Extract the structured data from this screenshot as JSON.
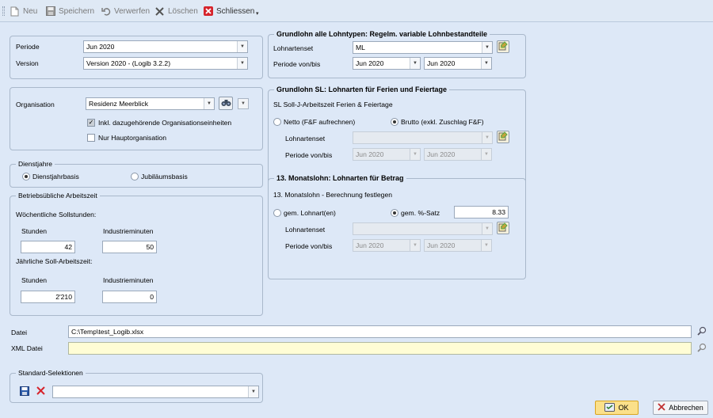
{
  "toolbar": {
    "neu": "Neu",
    "speichern": "Speichern",
    "verwerfen": "Verwerfen",
    "loeschen": "Löschen",
    "schliessen": "Schliessen",
    "overflow": "▾"
  },
  "periode": {
    "label": "Periode",
    "value": "Jun 2020"
  },
  "version": {
    "label": "Version",
    "value": "Version 2020 - (Logib 3.2.2)"
  },
  "organisation": {
    "label": "Organisation",
    "value": "Residenz Meerblick",
    "chk_inkl": "Inkl. dazugehörende Organisationseinheiten",
    "chk_inkl_checked": true,
    "chk_haupt": "Nur Hauptorganisation",
    "chk_haupt_checked": false
  },
  "dienstjahre": {
    "title": "Dienstjahre",
    "opt1": "Dienstjahrbasis",
    "opt2": "Jubiläumsbasis",
    "selected": "Dienstjahrbasis"
  },
  "arbeitszeit": {
    "title": "Betriebsübliche Arbeitszeit",
    "weekly_label": "Wöchentliche Sollstunden:",
    "yearly_label": "Jährliche Soll-Arbeitszeit:",
    "stunden_label": "Stunden",
    "industrie_label": "Industrieminuten",
    "weekly_stunden": "42",
    "weekly_industrie": "50",
    "yearly_stunden": "2'210",
    "yearly_industrie": "0"
  },
  "grundlohn_alle": {
    "title": "Grundlohn alle Lohntypen: Regelm. variable Lohnbestandteile",
    "lohnartenset_label": "Lohnartenset",
    "lohnartenset_value": "ML",
    "periode_label": "Periode von/bis",
    "von": "Jun 2020",
    "bis": "Jun 2020"
  },
  "grundlohn_sl": {
    "title": "Grundlohn SL: Lohnarten für Ferien und Feiertage",
    "subtitle": "SL Soll-J-Arbeitszeit Ferien & Feiertage",
    "opt_netto": "Netto (F&F aufrechnen)",
    "opt_brutto": "Brutto (exkl. Zuschlag F&F)",
    "selected": "Brutto",
    "lohnartenset_label": "Lohnartenset",
    "lohnartenset_value": "",
    "periode_label": "Periode von/bis",
    "von": "Jun 2020",
    "bis": "Jun 2020"
  },
  "monatslohn": {
    "title": "13. Monatslohn: Lohnarten für Betrag",
    "subtitle": "13. Monatslohn - Berechnung festlegen",
    "opt_lohnart": "gem. Lohnart(en)",
    "opt_satz": "gem. %-Satz",
    "selected": "gem. %-Satz",
    "satz_value": "8.33",
    "lohnartenset_label": "Lohnartenset",
    "lohnartenset_value": "",
    "periode_label": "Periode von/bis",
    "von": "Jun 2020",
    "bis": "Jun 2020"
  },
  "datei": {
    "label": "Datei",
    "value": "C:\\Temp\\test_Logib.xlsx"
  },
  "xml_datei": {
    "label": "XML Datei",
    "value": ""
  },
  "standard": {
    "title": "Standard-Selektionen",
    "value": ""
  },
  "buttons": {
    "ok": "OK",
    "abbrechen": "Abbrechen"
  },
  "colors": {
    "background": "#dde8f7",
    "ok_highlight": "#fbe08a",
    "delete_red": "#d6242c",
    "save_blue": "#2b5aa8"
  }
}
